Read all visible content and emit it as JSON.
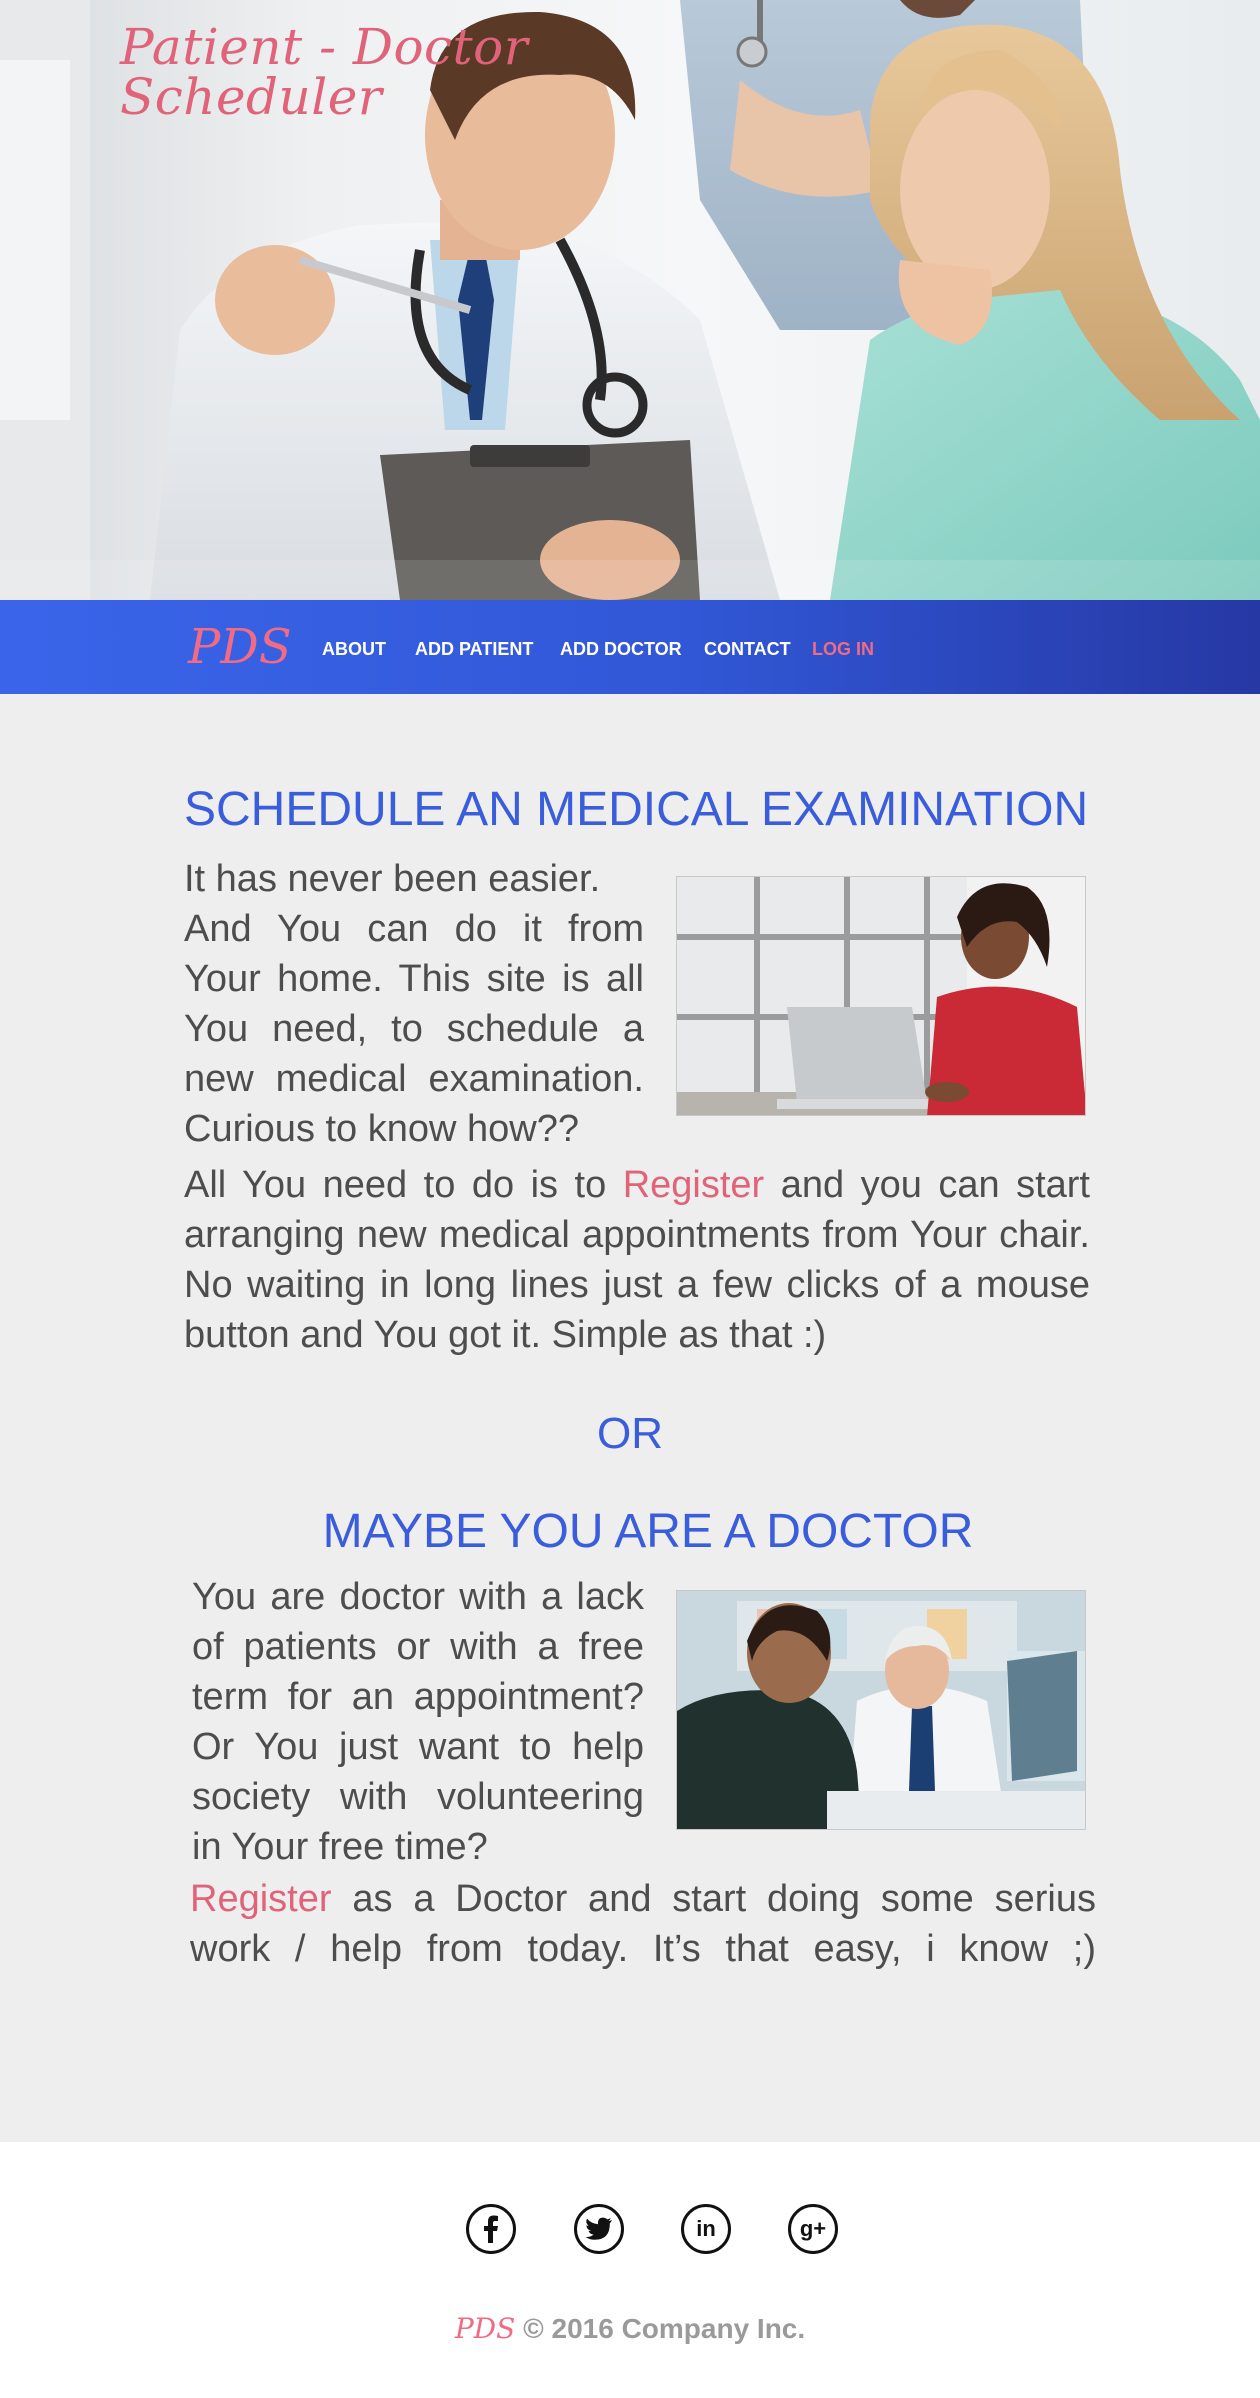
{
  "hero": {
    "title_line1": "Patient - Doctor",
    "title_line2": "Scheduler"
  },
  "nav": {
    "logo": "PDS",
    "items": [
      {
        "label": "ABOUT"
      },
      {
        "label": "ADD PATIENT"
      },
      {
        "label": "ADD DOCTOR"
      },
      {
        "label": "CONTACT"
      },
      {
        "label": "LOG IN"
      }
    ]
  },
  "patient_section": {
    "heading": "SCHEDULE AN MEDICAL EXAMINATION",
    "intro_lines": [
      "It has never been easier.",
      "And You can do it from Your home. This site is all You need, to schedule a new medical examination. Curious to know how??"
    ],
    "body_before": "All You need to do is to ",
    "register_link": "Register",
    "body_after": " and you can start arranging new medical appointments from Your chair. No waiting in long lines just a few clicks of a mouse button and You got it. Simple as that :)"
  },
  "separator": "OR",
  "doctor_section": {
    "heading": "MAYBE YOU ARE A DOCTOR",
    "intro": "You are doctor with a lack of patients or with a free term for an appointment? Or You just want to help society with volunteering in Your free time?",
    "register_link": "Register",
    "body_after": " as a  Doctor and start doing some serius work / help from today. It’s that easy, i know ;)"
  },
  "footer": {
    "social": [
      {
        "name": "facebook-icon",
        "glyph": "f"
      },
      {
        "name": "twitter-icon",
        "glyph": "🐦"
      },
      {
        "name": "linkedin-icon",
        "glyph": "in"
      },
      {
        "name": "google-plus-icon",
        "glyph": "g+"
      }
    ],
    "brand": "PDS",
    "copyright": " © 2016 Company Inc."
  },
  "colors": {
    "accent_blue": "#3a5ddb",
    "accent_pink": "#e0637a",
    "nav_gradient_start": "#3a65ea",
    "nav_gradient_end": "#2638a4"
  }
}
